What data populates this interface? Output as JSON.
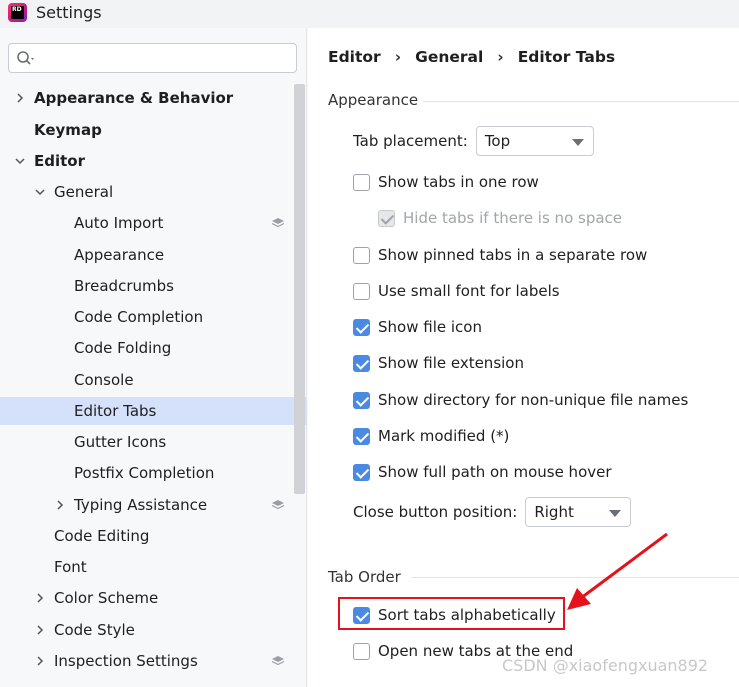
{
  "window": {
    "title": "Settings",
    "app_icon_text": "RD"
  },
  "search": {
    "value": "",
    "placeholder": ""
  },
  "tree": {
    "appearance_behavior": "Appearance & Behavior",
    "keymap": "Keymap",
    "editor": "Editor",
    "general": "General",
    "auto_import": "Auto Import",
    "appearance": "Appearance",
    "breadcrumbs": "Breadcrumbs",
    "code_completion": "Code Completion",
    "code_folding": "Code Folding",
    "console": "Console",
    "editor_tabs": "Editor Tabs",
    "gutter_icons": "Gutter Icons",
    "postfix_completion": "Postfix Completion",
    "typing_assistance": "Typing Assistance",
    "code_editing": "Code Editing",
    "font": "Font",
    "color_scheme": "Color Scheme",
    "code_style": "Code Style",
    "inspection_settings": "Inspection Settings"
  },
  "breadcrumb": {
    "part1": "Editor",
    "sep": "›",
    "part2": "General",
    "part3": "Editor Tabs"
  },
  "appearance_section": {
    "title": "Appearance",
    "tab_placement_label": "Tab placement:",
    "tab_placement_value": "Top",
    "show_tabs_one_row": "Show tabs in one row",
    "hide_tabs_no_space": "Hide tabs if there is no space",
    "show_pinned_separate": "Show pinned tabs in a separate row",
    "use_small_font": "Use small font for labels",
    "show_file_icon": "Show file icon",
    "show_file_extension": "Show file extension",
    "show_directory": "Show directory for non-unique file names",
    "mark_modified": "Mark modified (*)",
    "show_full_path": "Show full path on mouse hover",
    "close_button_label": "Close button position:",
    "close_button_value": "Right"
  },
  "tab_order_section": {
    "title": "Tab Order",
    "sort_alphabetically": "Sort tabs alphabetically",
    "open_new_at_end": "Open new tabs at the end"
  },
  "watermark": "CSDN @xiaofengxuan892",
  "colors": {
    "accent": "#4b8ae3",
    "selection": "#d5e1fa",
    "annotation": "#e5121b"
  }
}
